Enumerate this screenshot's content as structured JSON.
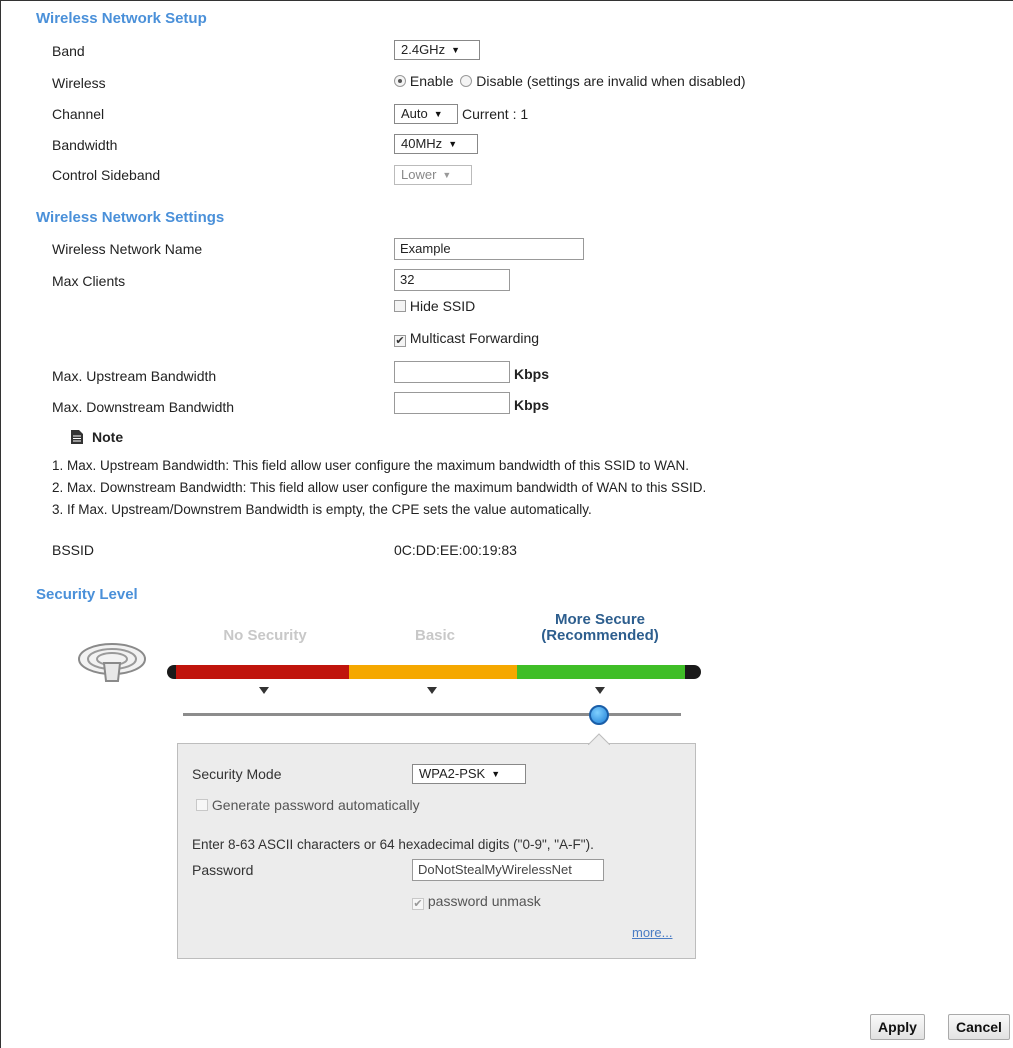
{
  "wireless_setup": {
    "title": "Wireless Network Setup",
    "band": {
      "label": "Band",
      "value": "2.4GHz"
    },
    "wireless": {
      "label": "Wireless",
      "enable_label": "Enable",
      "disable_label": "Disable (settings are invalid when disabled)",
      "selected": "Enable"
    },
    "channel": {
      "label": "Channel",
      "value": "Auto",
      "current_text": "Current : 1"
    },
    "bandwidth": {
      "label": "Bandwidth",
      "value": "40MHz"
    },
    "control_sideband": {
      "label": "Control Sideband",
      "value": "Lower",
      "disabled": true
    }
  },
  "wireless_settings": {
    "title": "Wireless Network Settings",
    "network_name": {
      "label": "Wireless Network Name",
      "value": "Example"
    },
    "max_clients": {
      "label": "Max Clients",
      "value": "32"
    },
    "hide_ssid": {
      "label": "Hide SSID",
      "checked": false
    },
    "multicast_forwarding": {
      "label": "Multicast Forwarding",
      "checked": true
    },
    "max_upstream": {
      "label": "Max. Upstream Bandwidth",
      "value": "",
      "unit": "Kbps"
    },
    "max_downstream": {
      "label": "Max. Downstream Bandwidth",
      "value": "",
      "unit": "Kbps"
    },
    "note": {
      "title": "Note",
      "icon": "note-icon",
      "items": [
        "1. Max. Upstream Bandwidth: This field allow user configure the maximum bandwidth of this SSID to WAN.",
        "2. Max. Downstream Bandwidth: This field allow user configure the maximum bandwidth of WAN to this SSID.",
        "3. If Max. Upstream/Downstrem Bandwidth is empty, the CPE sets the value automatically."
      ]
    },
    "bssid": {
      "label": "BSSID",
      "value": "0C:DD:EE:00:19:83"
    }
  },
  "security": {
    "title": "Security Level",
    "levels": [
      {
        "label": "No Security",
        "active": false
      },
      {
        "label": "Basic",
        "active": false
      },
      {
        "label_line1": "More Secure",
        "label_line2": "(Recommended)",
        "active": true
      }
    ],
    "selected_level_index": 2,
    "colors": {
      "red": "#c0140c",
      "orange": "#f5a800",
      "green": "#3fbe27",
      "inactive_label": "#c8c8c8",
      "active_label": "#2d5e8e"
    },
    "mode": {
      "label": "Security Mode",
      "value": "WPA2-PSK"
    },
    "generate_password": {
      "label": "Generate password automatically",
      "checked": false,
      "disabled": true
    },
    "hint": "Enter 8-63 ASCII characters or 64 hexadecimal digits (\"0-9\", \"A-F\").",
    "password": {
      "label": "Password",
      "value": "DoNotStealMyWirelessNet"
    },
    "unmask": {
      "label": "password unmask",
      "checked": true,
      "disabled": true
    },
    "more_link": "more..."
  },
  "actions": {
    "apply": "Apply",
    "cancel": "Cancel"
  }
}
